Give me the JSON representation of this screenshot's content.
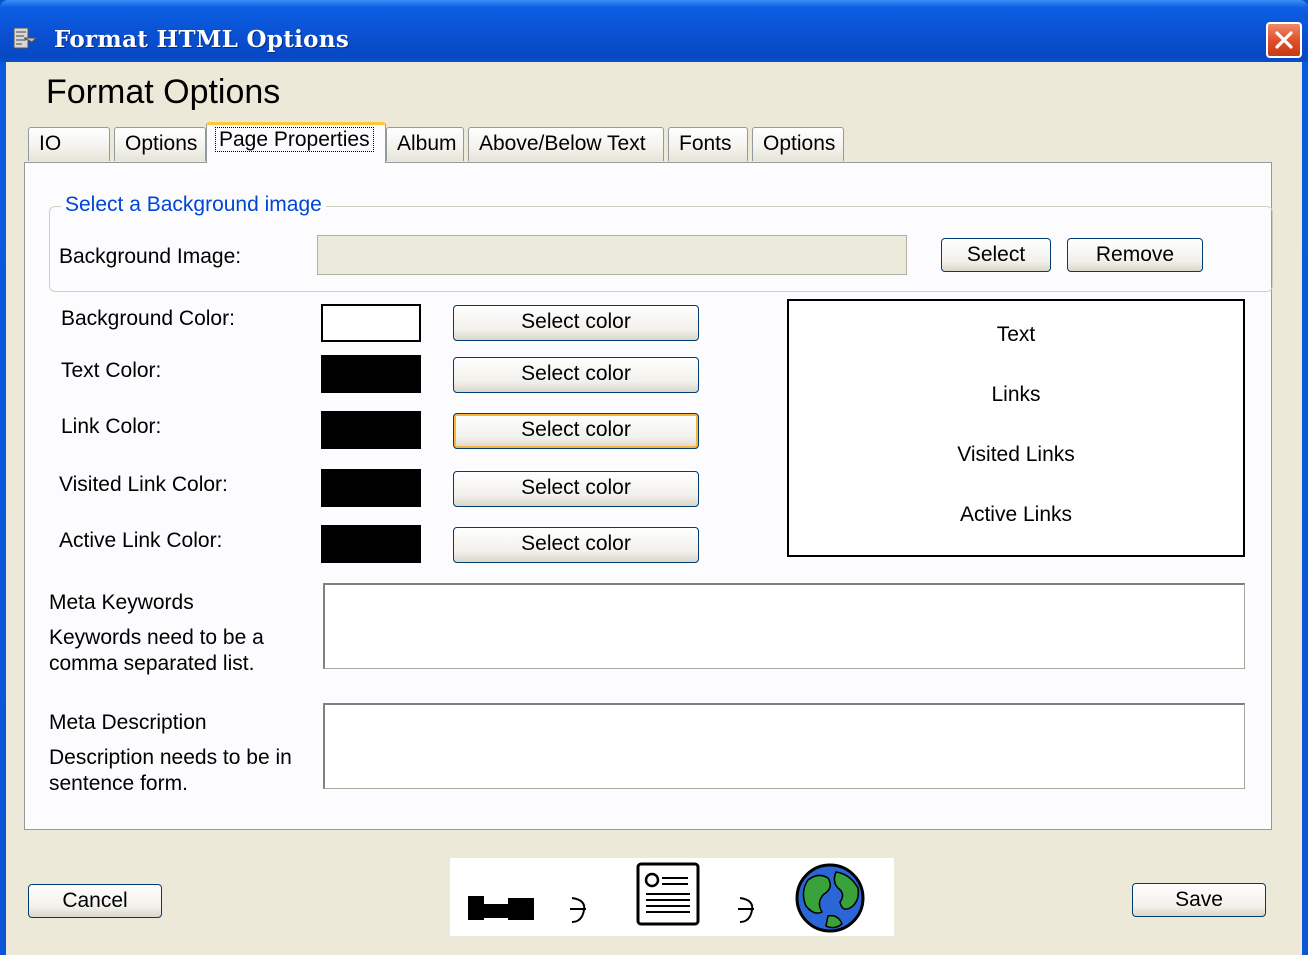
{
  "window": {
    "title": "Format HTML Options",
    "icon": "document-options-icon",
    "close_icon": "close-x-icon"
  },
  "heading": "Format Options",
  "tabs": [
    {
      "label": "IO"
    },
    {
      "label": "Options"
    },
    {
      "label": "Page Properties",
      "selected": true
    },
    {
      "label": "Album"
    },
    {
      "label": "Above/Below Text"
    },
    {
      "label": "Fonts"
    },
    {
      "label": "Options"
    }
  ],
  "background_group": {
    "legend": "Select a Background image",
    "label": "Background Image:",
    "value": "",
    "select_label": "Select",
    "remove_label": "Remove"
  },
  "colors": [
    {
      "label": "Background Color:",
      "swatch": "#ffffff",
      "button": "Select color"
    },
    {
      "label": "Text Color:",
      "swatch": "#000000",
      "button": "Select color"
    },
    {
      "label": "Link Color:",
      "swatch": "#000000",
      "button": "Select color",
      "focused": true
    },
    {
      "label": "Visited Link Color:",
      "swatch": "#000000",
      "button": "Select color"
    },
    {
      "label": "Active Link Color:",
      "swatch": "#000000",
      "button": "Select color"
    }
  ],
  "preview": {
    "text": "Text",
    "links": "Links",
    "visited": "Visited Links",
    "active": "Active Links"
  },
  "meta_keywords": {
    "label": "Meta Keywords",
    "hint": "Keywords need to be a comma separated list.",
    "value": ""
  },
  "meta_description": {
    "label": "Meta Description",
    "hint": "Description needs to be in sentence form.",
    "value": ""
  },
  "footer": {
    "cancel_label": "Cancel",
    "save_label": "Save",
    "steps_icons": [
      "camera-icon",
      "arrow-icon",
      "document-icon",
      "arrow-icon",
      "globe-icon"
    ]
  },
  "accent_colors": {
    "title_bar": "#0a52d4",
    "legend_text": "#0046d5",
    "tab_highlight": "#ffc83c",
    "dialog_bg": "#ece9d8"
  }
}
